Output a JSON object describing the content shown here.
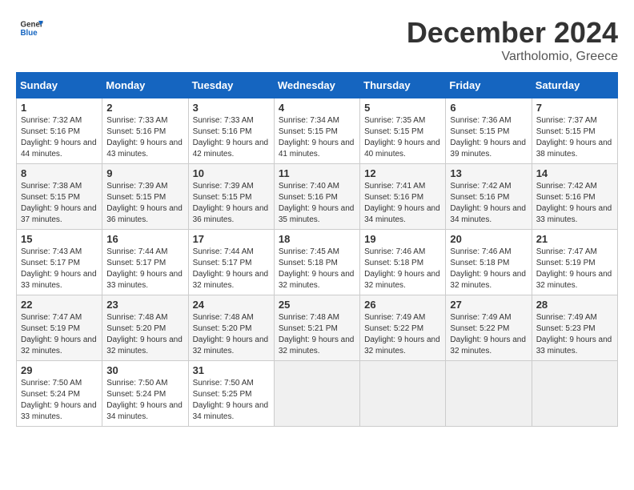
{
  "header": {
    "logo_general": "General",
    "logo_blue": "Blue",
    "month": "December 2024",
    "location": "Vartholomio, Greece"
  },
  "weekdays": [
    "Sunday",
    "Monday",
    "Tuesday",
    "Wednesday",
    "Thursday",
    "Friday",
    "Saturday"
  ],
  "weeks": [
    [
      {
        "day": "1",
        "sunrise": "7:32 AM",
        "sunset": "5:16 PM",
        "daylight": "9 hours and 44 minutes."
      },
      {
        "day": "2",
        "sunrise": "7:33 AM",
        "sunset": "5:16 PM",
        "daylight": "9 hours and 43 minutes."
      },
      {
        "day": "3",
        "sunrise": "7:33 AM",
        "sunset": "5:16 PM",
        "daylight": "9 hours and 42 minutes."
      },
      {
        "day": "4",
        "sunrise": "7:34 AM",
        "sunset": "5:15 PM",
        "daylight": "9 hours and 41 minutes."
      },
      {
        "day": "5",
        "sunrise": "7:35 AM",
        "sunset": "5:15 PM",
        "daylight": "9 hours and 40 minutes."
      },
      {
        "day": "6",
        "sunrise": "7:36 AM",
        "sunset": "5:15 PM",
        "daylight": "9 hours and 39 minutes."
      },
      {
        "day": "7",
        "sunrise": "7:37 AM",
        "sunset": "5:15 PM",
        "daylight": "9 hours and 38 minutes."
      }
    ],
    [
      {
        "day": "8",
        "sunrise": "7:38 AM",
        "sunset": "5:15 PM",
        "daylight": "9 hours and 37 minutes."
      },
      {
        "day": "9",
        "sunrise": "7:39 AM",
        "sunset": "5:15 PM",
        "daylight": "9 hours and 36 minutes."
      },
      {
        "day": "10",
        "sunrise": "7:39 AM",
        "sunset": "5:15 PM",
        "daylight": "9 hours and 36 minutes."
      },
      {
        "day": "11",
        "sunrise": "7:40 AM",
        "sunset": "5:16 PM",
        "daylight": "9 hours and 35 minutes."
      },
      {
        "day": "12",
        "sunrise": "7:41 AM",
        "sunset": "5:16 PM",
        "daylight": "9 hours and 34 minutes."
      },
      {
        "day": "13",
        "sunrise": "7:42 AM",
        "sunset": "5:16 PM",
        "daylight": "9 hours and 34 minutes."
      },
      {
        "day": "14",
        "sunrise": "7:42 AM",
        "sunset": "5:16 PM",
        "daylight": "9 hours and 33 minutes."
      }
    ],
    [
      {
        "day": "15",
        "sunrise": "7:43 AM",
        "sunset": "5:17 PM",
        "daylight": "9 hours and 33 minutes."
      },
      {
        "day": "16",
        "sunrise": "7:44 AM",
        "sunset": "5:17 PM",
        "daylight": "9 hours and 33 minutes."
      },
      {
        "day": "17",
        "sunrise": "7:44 AM",
        "sunset": "5:17 PM",
        "daylight": "9 hours and 32 minutes."
      },
      {
        "day": "18",
        "sunrise": "7:45 AM",
        "sunset": "5:18 PM",
        "daylight": "9 hours and 32 minutes."
      },
      {
        "day": "19",
        "sunrise": "7:46 AM",
        "sunset": "5:18 PM",
        "daylight": "9 hours and 32 minutes."
      },
      {
        "day": "20",
        "sunrise": "7:46 AM",
        "sunset": "5:18 PM",
        "daylight": "9 hours and 32 minutes."
      },
      {
        "day": "21",
        "sunrise": "7:47 AM",
        "sunset": "5:19 PM",
        "daylight": "9 hours and 32 minutes."
      }
    ],
    [
      {
        "day": "22",
        "sunrise": "7:47 AM",
        "sunset": "5:19 PM",
        "daylight": "9 hours and 32 minutes."
      },
      {
        "day": "23",
        "sunrise": "7:48 AM",
        "sunset": "5:20 PM",
        "daylight": "9 hours and 32 minutes."
      },
      {
        "day": "24",
        "sunrise": "7:48 AM",
        "sunset": "5:20 PM",
        "daylight": "9 hours and 32 minutes."
      },
      {
        "day": "25",
        "sunrise": "7:48 AM",
        "sunset": "5:21 PM",
        "daylight": "9 hours and 32 minutes."
      },
      {
        "day": "26",
        "sunrise": "7:49 AM",
        "sunset": "5:22 PM",
        "daylight": "9 hours and 32 minutes."
      },
      {
        "day": "27",
        "sunrise": "7:49 AM",
        "sunset": "5:22 PM",
        "daylight": "9 hours and 32 minutes."
      },
      {
        "day": "28",
        "sunrise": "7:49 AM",
        "sunset": "5:23 PM",
        "daylight": "9 hours and 33 minutes."
      }
    ],
    [
      {
        "day": "29",
        "sunrise": "7:50 AM",
        "sunset": "5:24 PM",
        "daylight": "9 hours and 33 minutes."
      },
      {
        "day": "30",
        "sunrise": "7:50 AM",
        "sunset": "5:24 PM",
        "daylight": "9 hours and 34 minutes."
      },
      {
        "day": "31",
        "sunrise": "7:50 AM",
        "sunset": "5:25 PM",
        "daylight": "9 hours and 34 minutes."
      },
      null,
      null,
      null,
      null
    ]
  ]
}
